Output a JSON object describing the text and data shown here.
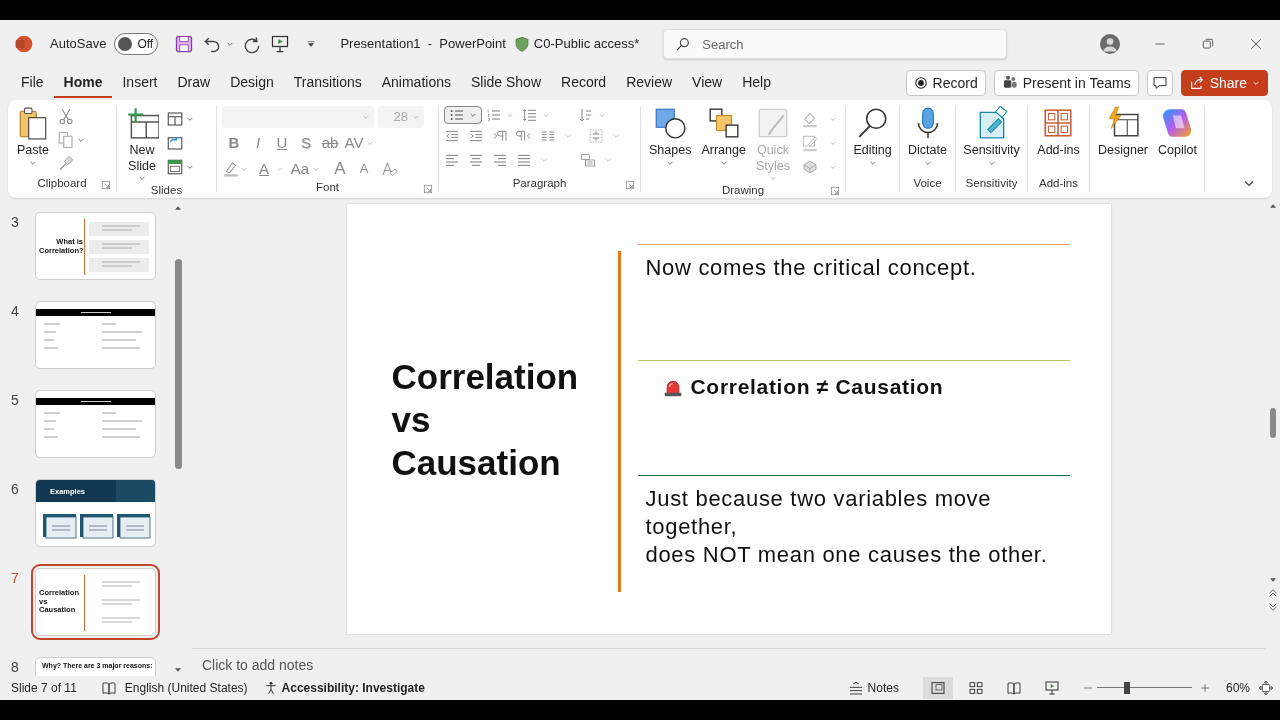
{
  "title_bar": {
    "autosave_label": "AutoSave",
    "autosave": {
      "on": false,
      "label": "Off"
    },
    "document_title": "Presentation1  -  PowerPoint",
    "sensitivity_label": "C0-Public access*",
    "search": {
      "placeholder": "Search"
    }
  },
  "menu_tabs": [
    {
      "label": "File",
      "selected": false
    },
    {
      "label": "Home",
      "selected": true
    },
    {
      "label": "Insert",
      "selected": false
    },
    {
      "label": "Draw",
      "selected": false
    },
    {
      "label": "Design",
      "selected": false
    },
    {
      "label": "Transitions",
      "selected": false
    },
    {
      "label": "Animations",
      "selected": false
    },
    {
      "label": "Slide Show",
      "selected": false
    },
    {
      "label": "Record",
      "selected": false
    },
    {
      "label": "Review",
      "selected": false
    },
    {
      "label": "View",
      "selected": false
    },
    {
      "label": "Help",
      "selected": false
    }
  ],
  "header_buttons": [
    {
      "label": "Record"
    },
    {
      "label": "Present in Teams"
    },
    {
      "label": "Share"
    }
  ],
  "ribbon": {
    "groups": [
      {
        "label": "Clipboard",
        "buttons": [
          {
            "label": "Paste"
          }
        ]
      },
      {
        "label": "Slides",
        "buttons": [
          {
            "label": "New\nSlide"
          }
        ]
      },
      {
        "label": "Font",
        "font_size": "28",
        "glyphs": [
          "B",
          "I",
          "U",
          "S",
          "ab",
          "AV",
          "A",
          "Aa",
          "A",
          "A"
        ]
      },
      {
        "label": "Paragraph",
        "bullets_selected": true
      },
      {
        "label": "Drawing",
        "buttons": [
          {
            "label": "Shapes",
            "disabled": false
          },
          {
            "label": "Arrange",
            "disabled": false
          },
          {
            "label": "Quick\nStyles",
            "disabled": true
          }
        ]
      },
      {
        "buttons": [
          {
            "label": "Editing"
          }
        ]
      },
      {
        "label": "Voice",
        "buttons": [
          {
            "label": "Dictate"
          }
        ]
      },
      {
        "label": "Sensitivity",
        "buttons": [
          {
            "label": "Sensitivity"
          }
        ]
      },
      {
        "label": "Add-ins",
        "buttons": [
          {
            "label": "Add-ins"
          }
        ]
      },
      {
        "buttons": [
          {
            "label": "Designer"
          },
          {
            "label": "Copilot"
          }
        ]
      }
    ]
  },
  "thumbnails": [
    {
      "number": "3",
      "kind": "split",
      "title": "What is\nCorrelation?",
      "selected": false
    },
    {
      "number": "4",
      "kind": "table",
      "selected": false
    },
    {
      "number": "5",
      "kind": "table",
      "selected": false
    },
    {
      "number": "6",
      "kind": "banner",
      "title": "Examples",
      "selected": false
    },
    {
      "number": "7",
      "kind": "split",
      "title": "Correlation\nvs\nCausation",
      "selected": true
    },
    {
      "number": "8",
      "kind": "plain",
      "title": "Why? There are 3 major reasons:",
      "selected": false
    }
  ],
  "slide": {
    "title": "Correlation vs Causation",
    "points": [
      {
        "kind": "plain",
        "text": "Now comes the critical concept.",
        "color": "#e3a171"
      },
      {
        "kind": "alert",
        "text": "Correlation ≠ Causation",
        "color": "#b3c36b"
      },
      {
        "kind": "plain",
        "text": "Just because two variables move\ntogether,\ndoes NOT mean one causes the other.",
        "color": "#2f6a3b"
      }
    ]
  },
  "notes": {
    "placeholder": "Click to add notes"
  },
  "status_bar": {
    "slide_info": "Slide 7 of 11",
    "language": "English (United States)",
    "accessibility": "Accessibility: Investigate",
    "notes_label": "Notes",
    "zoom": {
      "level": 0.32,
      "reading": "60%"
    }
  }
}
